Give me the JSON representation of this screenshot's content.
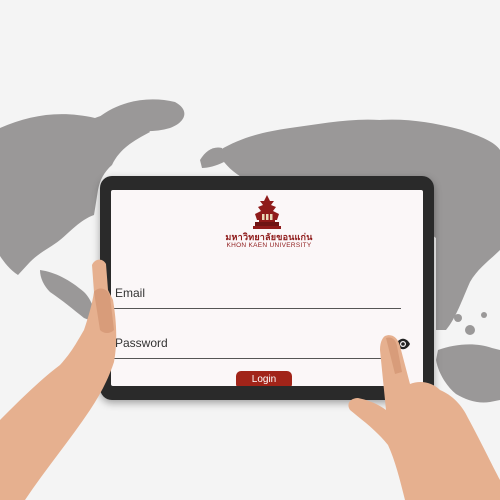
{
  "university": {
    "name_thai": "มหาวิทยาลัยขอนแก่น",
    "name_english": "KHON KAEN UNIVERSITY"
  },
  "form": {
    "email_label": "Email",
    "password_label": "Password",
    "login_label": "Login"
  },
  "icons": {
    "password_toggle": "eye-icon",
    "logo": "university-emblem-icon"
  },
  "colors": {
    "brand": "#8f1b1b",
    "button": "#a12419"
  }
}
